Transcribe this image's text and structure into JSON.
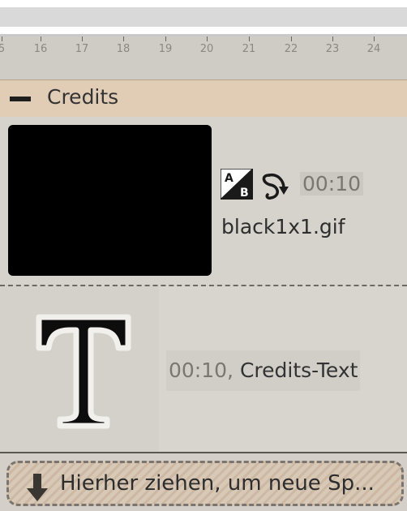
{
  "ruler": {
    "ticks": [
      "5",
      "16",
      "17",
      "18",
      "19",
      "20",
      "21",
      "22",
      "23",
      "24"
    ]
  },
  "group": {
    "title": "Credits"
  },
  "slides": [
    {
      "duration": "00:10",
      "filename": "black1x1.gif",
      "transition_icon": "transition-ab-icon",
      "motion_icon": "motion-path-arrow-icon"
    },
    {
      "duration": "00:10,",
      "label": "Credits-Text",
      "icon": "text-t-icon"
    }
  ],
  "dropzone": {
    "label": "Hierher ziehen, um neue Sp...",
    "icon": "down-arrow-icon"
  },
  "colors": {
    "group_header": "#e1cdb5",
    "timeline_bg": "#d4d0c9"
  }
}
